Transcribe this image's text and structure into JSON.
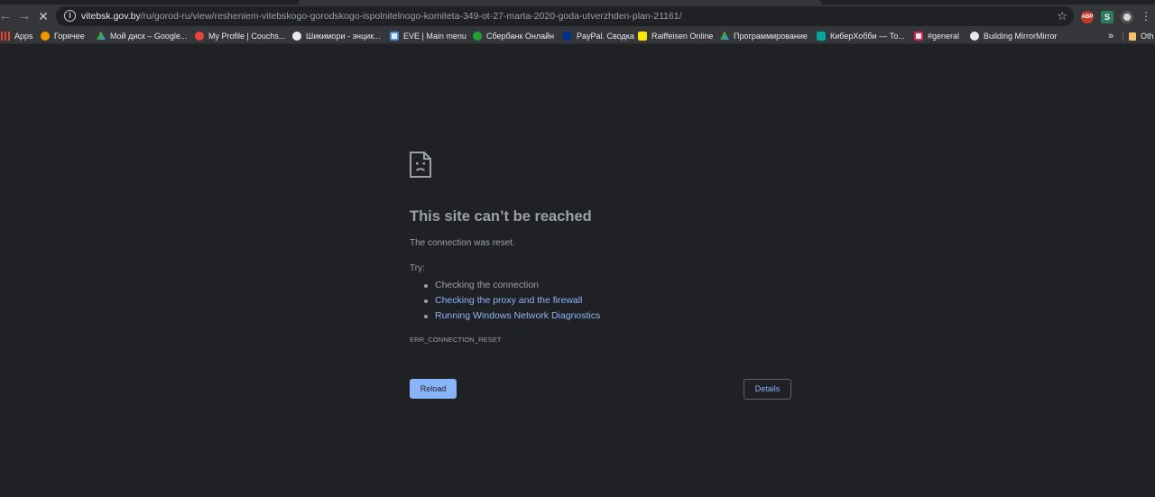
{
  "tab": {
    "title": ""
  },
  "toolbar": {
    "back_icon": "arrow-left-icon",
    "forward_icon": "arrow-right-icon",
    "stop_icon": "close-icon",
    "url_host": "vitebsk.gov.by",
    "url_path": "/ru/gorod-ru/view/resheniem-vitebskogo-gorodskogo-ispolnitelnogo-komiteta-349-ot-27-marta-2020-goda-utverzhden-plan-21161/",
    "extensions": [
      "ABP",
      "S",
      ""
    ]
  },
  "bookmarks": {
    "items": [
      {
        "label": "Apps",
        "icon": "apps-grid-icon",
        "color": "#ea4335"
      },
      {
        "label": "Горячее",
        "icon": "fire-icon",
        "color": "#f29900"
      },
      {
        "label": "Мой диск – Google...",
        "icon": "google-drive-icon",
        "color": "#34a853"
      },
      {
        "label": "My Profile | Couchs...",
        "icon": "couchsurfing-icon",
        "color": "#e8453c"
      },
      {
        "label": "Шикимори - энцик...",
        "icon": "shikimori-icon",
        "color": "#e8eaed"
      },
      {
        "label": "EVE | Main menu",
        "icon": "eve-icon",
        "color": "#4a90d9"
      },
      {
        "label": "Сбербанк Онлайн",
        "icon": "sberbank-icon",
        "color": "#21a038"
      },
      {
        "label": "PayPal. Сводка",
        "icon": "paypal-icon",
        "color": "#009cde"
      },
      {
        "label": "Raiffeisen Online",
        "icon": "raiffeisen-icon",
        "color": "#fee600"
      },
      {
        "label": "Программирование",
        "icon": "google-drive-icon",
        "color": "#34a853"
      },
      {
        "label": "КиберХобби — То...",
        "icon": "cyberhobby-icon",
        "color": "#00a99d"
      },
      {
        "label": "#general",
        "icon": "slack-icon",
        "color": "#e01e5a"
      },
      {
        "label": "Building MirrorMirror",
        "icon": "globe-icon",
        "color": "#e8eaed"
      }
    ],
    "more": "»",
    "other": "Oth"
  },
  "error": {
    "icon": "sad-page-icon",
    "title": "This site can’t be reached",
    "subtitle": "The connection was reset.",
    "try_label": "Try:",
    "suggestions": [
      {
        "text": "Checking the connection",
        "link": false
      },
      {
        "text": "Checking the proxy and the firewall",
        "link": true
      },
      {
        "text": "Running Windows Network Diagnostics",
        "link": true
      }
    ],
    "code": "ERR_CONNECTION_RESET",
    "reload_label": "Reload",
    "details_label": "Details"
  },
  "colors": {
    "background": "#202124",
    "toolbar": "#35363a",
    "link": "#8ab4f8",
    "text": "#9aa0a6"
  }
}
